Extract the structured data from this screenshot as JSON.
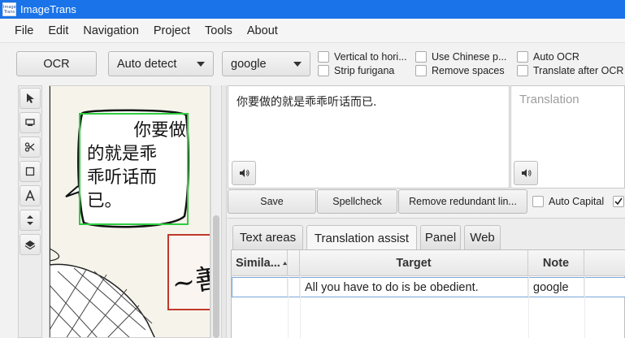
{
  "window": {
    "title": "ImageTrans",
    "icon_text": "Image Trans"
  },
  "menu": [
    "File",
    "Edit",
    "Navigation",
    "Project",
    "Tools",
    "About"
  ],
  "toolbar": {
    "ocr_label": "OCR",
    "lang_select": "Auto detect",
    "engine_select": "google",
    "checkboxes": {
      "vertical": "Vertical to hori...",
      "furigana": "Strip furigana",
      "chinese": "Use Chinese p...",
      "spaces": "Remove spaces",
      "auto_ocr": "Auto OCR",
      "translate_after": "Translate after OCR"
    }
  },
  "tools": [
    "pointer-icon",
    "region-icon",
    "scissors-icon",
    "rectangle-icon",
    "text-icon",
    "arrows-icon",
    "layers-icon"
  ],
  "canvas": {
    "bubble_text": [
      "你要做",
      "的就是乖",
      "乖听话而",
      "已。"
    ],
    "sign_text": "~善"
  },
  "source_text": "你要做的就是乖乖听话而已.",
  "translation_placeholder": "Translation",
  "actions": {
    "save": "Save",
    "spellcheck": "Spellcheck",
    "remove": "Remove redundant lin...",
    "auto_capital": "Auto Capital"
  },
  "tabs": [
    "Text areas",
    "Translation assist",
    "Panel",
    "Web"
  ],
  "table": {
    "headers": {
      "similarity": "Simila...",
      "target": "Target",
      "note": "Note"
    },
    "rows": [
      {
        "similarity": "",
        "target": "All you have to do is be obedient.",
        "note": "google"
      }
    ]
  },
  "colors": {
    "titlebar": "#1a73e8",
    "selection_box": "#2ecc40",
    "sign_border": "#c0392b"
  }
}
